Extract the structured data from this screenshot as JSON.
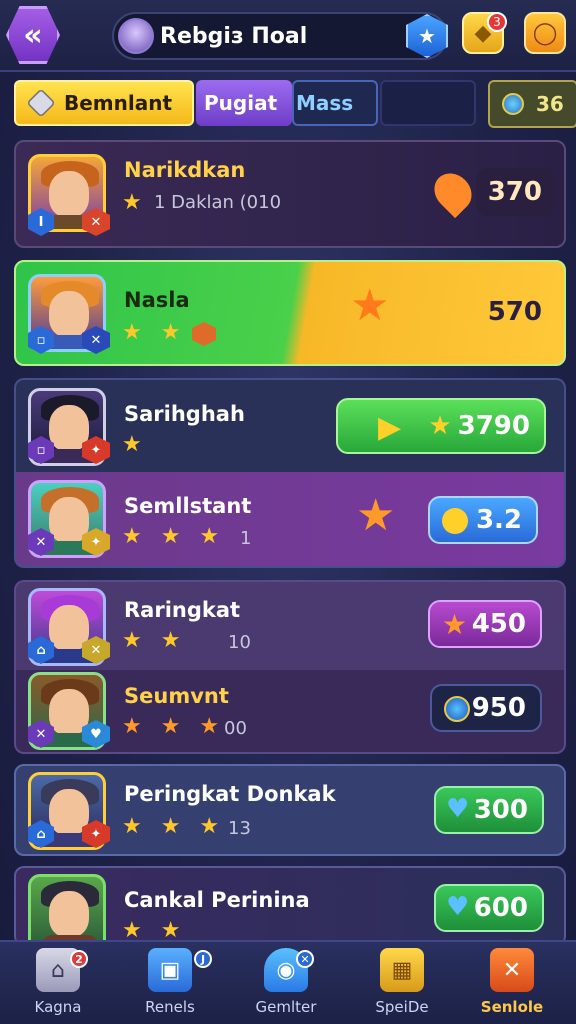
{
  "header": {
    "title": "Rebgiз Поаl",
    "back_glyph": "«",
    "star_glyph": "★",
    "notification_count": "3"
  },
  "tabs": [
    {
      "label": "Bemnlant",
      "active": true
    },
    {
      "label": "Pugiat",
      "active": false
    },
    {
      "label": "Mass",
      "active": false
    },
    {
      "label": "",
      "active": false
    }
  ],
  "currency": {
    "value": "36"
  },
  "rows": [
    {
      "name": "Narikdkan",
      "sub": "1 Daklan (010",
      "stars": "★",
      "score": "370",
      "score_prefix": "3"
    },
    {
      "name": "Nasla",
      "stars": "★ ★",
      "score": "570",
      "score_prefix": "5"
    },
    {
      "name": "Sarihghah",
      "stars": "★",
      "score": "3790"
    },
    {
      "name": "Semllstant",
      "stars": "★ ★ ★",
      "sub": "1",
      "score": "3.2"
    },
    {
      "name": "Raringkat",
      "stars": "★ ★",
      "sub": "10",
      "score": "450"
    },
    {
      "name": "Seumvnt",
      "stars": "★ ★ ★",
      "sub": "00",
      "score": "950"
    },
    {
      "name": "Peringkat Donkak",
      "stars": "★ ★ ★",
      "sub": "13",
      "score": "300"
    },
    {
      "name": "Cankal Perinina",
      "stars": "★ ★",
      "score": "600"
    }
  ],
  "nav": [
    {
      "label": "Kagna",
      "badge": "2"
    },
    {
      "label": "Renels",
      "badge": "J"
    },
    {
      "label": "Gemlter",
      "badge": "✕"
    },
    {
      "label": "SpeiDe",
      "badge": ""
    },
    {
      "label": "Senlole",
      "badge": ""
    }
  ],
  "colors": {
    "accent_yellow": "#f5b919",
    "accent_purple": "#7a44d0",
    "accent_green": "#2fc44a",
    "accent_blue": "#2a7ee6"
  }
}
